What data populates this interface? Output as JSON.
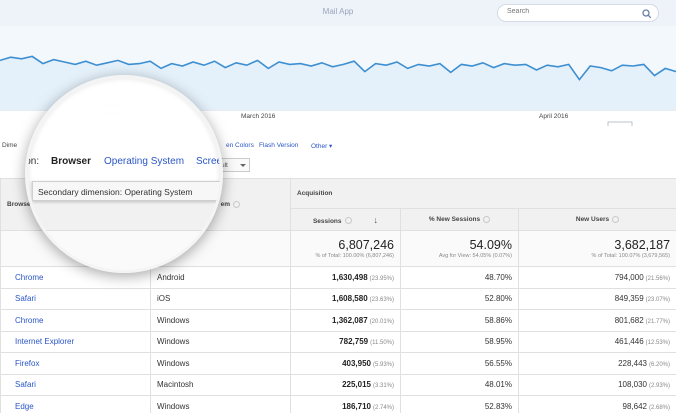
{
  "app": {
    "title": "Mail App"
  },
  "search": {
    "placeholder": "Search"
  },
  "chart": {
    "x_labels": [
      "March 2016",
      "April 2016"
    ]
  },
  "chart_data": {
    "type": "line",
    "series": [
      {
        "values": [
          62,
          66,
          64,
          67,
          58,
          63,
          60,
          57,
          61,
          56,
          59,
          62,
          57,
          58,
          61,
          52,
          58,
          55,
          60,
          56,
          61,
          53,
          59,
          56,
          62,
          52,
          60,
          57,
          58,
          55,
          59,
          54,
          57,
          61,
          48,
          58,
          56,
          60,
          52,
          57,
          55,
          58,
          47,
          57,
          55,
          59,
          53,
          58,
          56,
          57,
          50,
          56,
          54,
          57,
          38,
          55,
          53,
          49,
          56,
          55,
          57,
          43,
          52,
          48
        ]
      }
    ],
    "x_labels": [
      "March 2016",
      "April 2016"
    ],
    "grid": false
  },
  "dimension_bar": {
    "primary_label": "Dime",
    "links": [
      "en Colors",
      "Flash Version",
      "Other ▾"
    ]
  },
  "magnifier": {
    "dimension_label": "sion:",
    "dimension_selected": "Browser",
    "dimension_os": "Operating System",
    "dimension_screen": "Scree",
    "tooltip": "Secondary dimension: Operating System"
  },
  "toolbar": {
    "secondary_select_value": "ult"
  },
  "table": {
    "group_header": "Acquisition",
    "col_browser": "Browse",
    "col_os": "em",
    "col_sessions": "Sessions",
    "col_new_sessions": "% New Sessions",
    "col_new_users": "New Users",
    "totals": {
      "sessions": "6,807,246",
      "sessions_sub": "% of Total: 100.00% (6,807,246)",
      "new_sessions": "54.09%",
      "new_sessions_sub": "Avg for View: 54.05% (0.07%)",
      "new_users": "3,682,187",
      "new_users_sub": "% of Total: 100.07% (3,679,565)"
    },
    "rows": [
      {
        "browser": "Chrome",
        "os": "Android",
        "sessions": "1,630,498",
        "sessions_pct": "(23.95%)",
        "new_sessions": "48.70%",
        "new_users": "794,000",
        "new_users_pct": "(21.56%)"
      },
      {
        "browser": "Safari",
        "os": "iOS",
        "sessions": "1,608,580",
        "sessions_pct": "(23.63%)",
        "new_sessions": "52.80%",
        "new_users": "849,359",
        "new_users_pct": "(23.07%)"
      },
      {
        "browser": "Chrome",
        "os": "Windows",
        "sessions": "1,362,087",
        "sessions_pct": "(20.01%)",
        "new_sessions": "58.86%",
        "new_users": "801,682",
        "new_users_pct": "(21.77%)"
      },
      {
        "browser": "Internet Explorer",
        "os": "Windows",
        "sessions": "782,759",
        "sessions_pct": "(11.50%)",
        "new_sessions": "58.95%",
        "new_users": "461,446",
        "new_users_pct": "(12.53%)"
      },
      {
        "browser": "Firefox",
        "os": "Windows",
        "sessions": "403,950",
        "sessions_pct": "(5.93%)",
        "new_sessions": "56.55%",
        "new_users": "228,443",
        "new_users_pct": "(6.20%)"
      },
      {
        "browser": "Safari",
        "os": "Macintosh",
        "sessions": "225,015",
        "sessions_pct": "(3.31%)",
        "new_sessions": "48.01%",
        "new_users": "108,030",
        "new_users_pct": "(2.93%)"
      },
      {
        "browser": "Edge",
        "os": "Windows",
        "sessions": "186,710",
        "sessions_pct": "(2.74%)",
        "new_sessions": "52.83%",
        "new_users": "98,642",
        "new_users_pct": "(2.68%)"
      }
    ]
  }
}
